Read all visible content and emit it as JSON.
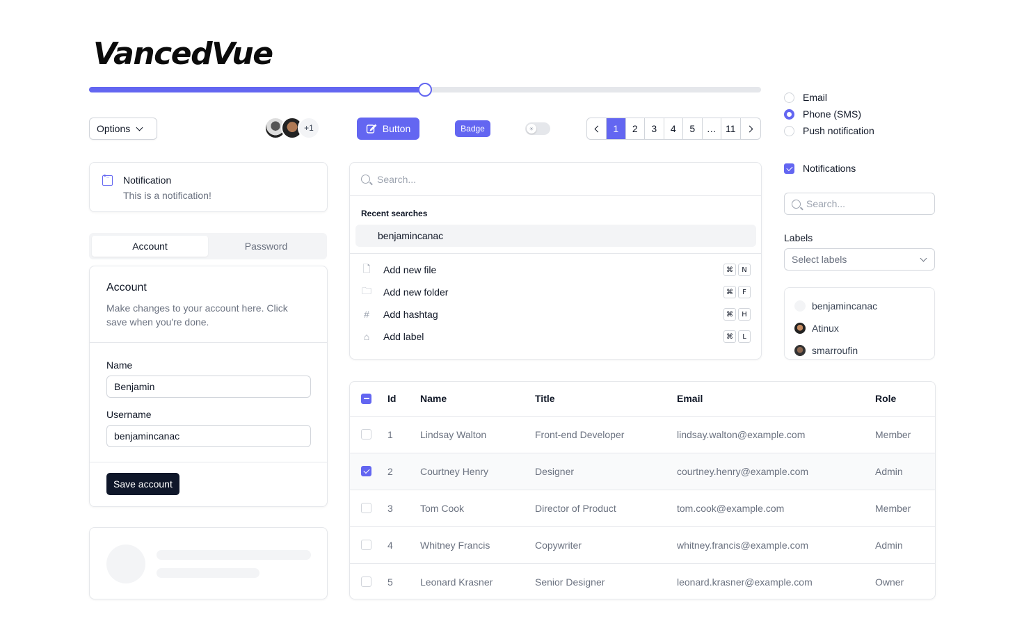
{
  "brand": {
    "logo": "VancedVue"
  },
  "slider": {
    "value": 0.5
  },
  "toolbar": {
    "options_label": "Options",
    "avatar_more": "+1",
    "button_label": "Button",
    "badge_label": "Badge",
    "toggle_on": false
  },
  "pagination": {
    "pages": [
      "1",
      "2",
      "3",
      "4",
      "5",
      "…",
      "11"
    ],
    "active": "1"
  },
  "radio_group": {
    "options": [
      "Email",
      "Phone (SMS)",
      "Push notification"
    ],
    "selected": "Phone (SMS)"
  },
  "notifications_checkbox": {
    "label": "Notifications",
    "checked": true
  },
  "right_search": {
    "placeholder": "Search..."
  },
  "labels": {
    "title": "Labels",
    "placeholder": "Select labels"
  },
  "users": [
    "benjamincanac",
    "Atinux",
    "smarroufin"
  ],
  "notification": {
    "title": "Notification",
    "description": "This is a notification!"
  },
  "tabs": [
    "Account",
    "Password"
  ],
  "account": {
    "title": "Account",
    "description": "Make changes to your account here. Click save when you're done.",
    "name_label": "Name",
    "name_value": "Benjamin",
    "username_label": "Username",
    "username_value": "benjamincanac",
    "save_label": "Save account"
  },
  "command_palette": {
    "placeholder": "Search...",
    "recent_label": "Recent searches",
    "recent": [
      "benjamincanac"
    ],
    "items": [
      {
        "label": "Add new file",
        "icon": "file-plus-icon",
        "shortcut": [
          "⌘",
          "N"
        ]
      },
      {
        "label": "Add new folder",
        "icon": "folder-plus-icon",
        "shortcut": [
          "⌘",
          "F"
        ]
      },
      {
        "label": "Add hashtag",
        "icon": "hashtag-icon",
        "shortcut": [
          "⌘",
          "H"
        ]
      },
      {
        "label": "Add label",
        "icon": "tag-icon",
        "shortcut": [
          "⌘",
          "L"
        ]
      }
    ]
  },
  "table": {
    "headers": {
      "id": "Id",
      "name": "Name",
      "title": "Title",
      "email": "Email",
      "role": "Role"
    },
    "rows": [
      {
        "id": "1",
        "name": "Lindsay Walton",
        "title": "Front-end Developer",
        "email": "lindsay.walton@example.com",
        "role": "Member",
        "selected": false
      },
      {
        "id": "2",
        "name": "Courtney Henry",
        "title": "Designer",
        "email": "courtney.henry@example.com",
        "role": "Admin",
        "selected": true
      },
      {
        "id": "3",
        "name": "Tom Cook",
        "title": "Director of Product",
        "email": "tom.cook@example.com",
        "role": "Member",
        "selected": false
      },
      {
        "id": "4",
        "name": "Whitney Francis",
        "title": "Copywriter",
        "email": "whitney.francis@example.com",
        "role": "Admin",
        "selected": false
      },
      {
        "id": "5",
        "name": "Leonard Krasner",
        "title": "Senior Designer",
        "email": "leonard.krasner@example.com",
        "role": "Owner",
        "selected": false
      }
    ]
  },
  "colors": {
    "primary": "#6366f1",
    "dark": "#0f172a",
    "muted": "#6b7280",
    "border": "#e5e7eb"
  }
}
